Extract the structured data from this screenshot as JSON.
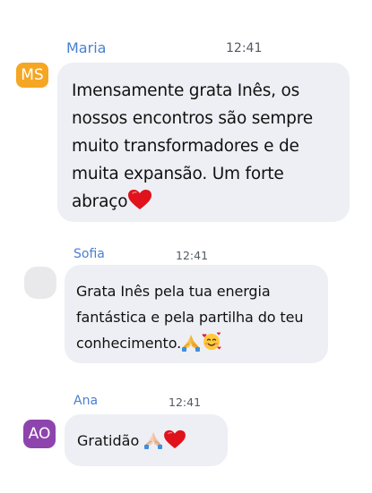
{
  "colors": {
    "name": "#4a7fd1",
    "time": "#555a62",
    "bubble": "#eeeff4",
    "avatar_ms": "#f5a623",
    "avatar_blank": "#e9e9ec",
    "avatar_ao": "#8e44ad"
  },
  "messages": [
    {
      "sender": "Maria",
      "time": "12:41",
      "avatar_initials": "MS",
      "text": "Imensamente grata Inês, os nossos encontros são sempre muito transformadores e de muita expansão. Um forte abraço",
      "emojis": [
        "red-heart"
      ]
    },
    {
      "sender": "Sofia",
      "time": "12:41",
      "avatar_initials": "",
      "text": "Grata Inês pela tua energia fantástica e pela partilha do teu conhecimento.",
      "emojis": [
        "folded-hands",
        "smiling-face-with-hearts"
      ]
    },
    {
      "sender": "Ana",
      "time": "12:41",
      "avatar_initials": "AO",
      "text": "Gratidão",
      "emojis": [
        "folded-hands",
        "red-heart"
      ]
    }
  ]
}
